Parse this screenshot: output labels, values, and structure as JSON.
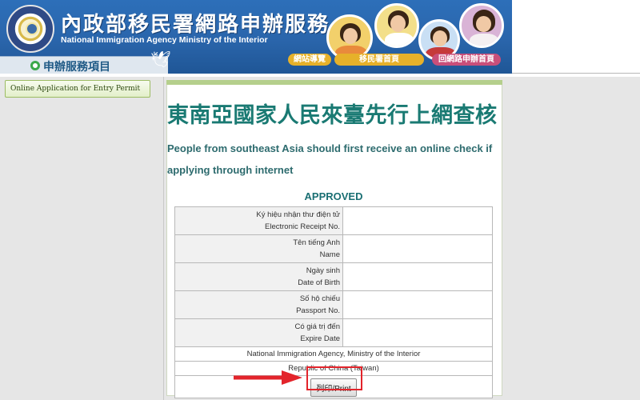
{
  "header": {
    "title_cn": "內政部移民署網路申辦服務",
    "title_en": "National Immigration Agency Ministry of the Interior",
    "service_label": "申辦服務項目",
    "nav": [
      "網站導覽",
      "移民署首頁",
      "回網路申辦首頁"
    ],
    "colors": {
      "banner": "#2a65ab",
      "nav_gold": "#e6b12a",
      "nav_pink": "#c94f7a"
    }
  },
  "sidebar": {
    "items": [
      {
        "label": "Online Application for Entry Permit"
      }
    ]
  },
  "main": {
    "title": "東南亞國家人民來臺先行上網查核",
    "subtitle": "People from southeast Asia should first receive an online check if applying through internet",
    "status": "APPROVED",
    "rows": [
      {
        "label_vi": "Ký hiệu nhận thư điện tử",
        "label_en": "Electronic Receipt No.",
        "value": ""
      },
      {
        "label_vi": "Tên tiếng Anh",
        "label_en": "Name",
        "value": ""
      },
      {
        "label_vi": "Ngày sinh",
        "label_en": "Date of Birth",
        "value": ""
      },
      {
        "label_vi": "Số hộ chiếu",
        "label_en": "Passport No.",
        "value": ""
      },
      {
        "label_vi": "Có giá trị đến",
        "label_en": "Expire Date",
        "value": ""
      }
    ],
    "agency": "National Immigration Agency, Ministry of the Interior",
    "country": "Republic of China (Taiwan)",
    "print_label": "列印/Print",
    "colors": {
      "title": "#1a7a73",
      "highlight": "#e3242b"
    }
  }
}
